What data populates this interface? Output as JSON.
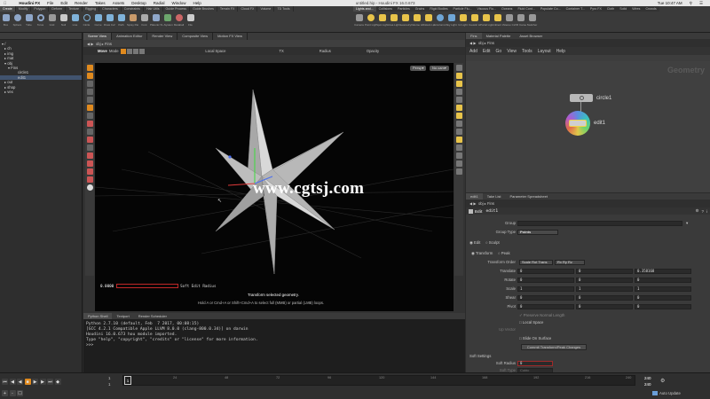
{
  "menubar": {
    "app": "Houdini FX",
    "items": [
      "File",
      "Edit",
      "Render",
      "Takes",
      "Assets",
      "Desktop",
      "Radial",
      "Window",
      "Help"
    ],
    "file_title": "untitled.hip - Houdini FX 16.0.673",
    "time": "Tue 10:47 AM"
  },
  "shelf": {
    "left_tabs": [
      "Create",
      "Modify",
      "Polygon",
      "Deform",
      "Texture",
      "Rigging",
      "Characters",
      "Constraints",
      "Hair Utils",
      "Guide Process",
      "Guide Brushes",
      "Terrain FX",
      "Cloud FX",
      "Volume",
      "TD Tools"
    ],
    "left_tools": [
      "Box",
      "Sphere",
      "Tube",
      "Torus",
      "Grid",
      "Null",
      "Line",
      "Circle",
      "Curve",
      "Draw Curve",
      "Path",
      "Spray Paint",
      "Font",
      "Platonic Solids",
      "L-System",
      "Metaball",
      "File"
    ],
    "right_tabs": [
      "Lights and...",
      "Collisions",
      "Particles",
      "Grains",
      "Rigid Bodies",
      "Particle Flu...",
      "Viscous Flu...",
      "Oceans",
      "Fluid Cont...",
      "Populate Co...",
      "Container T...",
      "Pyro FX",
      "Cloth",
      "Solid",
      "Wires",
      "Crowds",
      "Drive Simu..."
    ],
    "right_tools": [
      "Camera",
      "Point Light",
      "Spot Light",
      "Area Light",
      "Geometry Light",
      "Volume Light",
      "Distant Light",
      "Environment Light",
      "Sky Light",
      "GI Light",
      "Caustic Light",
      "Portal Light",
      "Ambient Light",
      "Stereo Camera",
      "VR Camera",
      "Switcher"
    ]
  },
  "tree": {
    "items": [
      {
        "label": "/",
        "indent": 0
      },
      {
        "label": "ch",
        "indent": 1
      },
      {
        "label": "img",
        "indent": 1
      },
      {
        "label": "mat",
        "indent": 1
      },
      {
        "label": "obj",
        "indent": 1
      },
      {
        "label": "Fins",
        "indent": 2
      },
      {
        "label": "circle1",
        "indent": 3
      },
      {
        "label": "edit1",
        "indent": 3,
        "selected": true
      },
      {
        "label": "out",
        "indent": 1
      },
      {
        "label": "shop",
        "indent": 1
      },
      {
        "label": "vex",
        "indent": 1
      }
    ]
  },
  "scene": {
    "tabs": [
      "Scene View",
      "Animation Editor",
      "Render View",
      "Composite View",
      "Motion FX View"
    ],
    "path": [
      "obj",
      "Fins"
    ],
    "tool_name": "Move",
    "mode_label": "Mode",
    "local_space": "Local Space",
    "field_tx": "TX",
    "field_radius": "Radius",
    "field_opacity": "Opacity",
    "persp": "Persp▾",
    "nocam": "No cam▾",
    "soft_value": "0.0000",
    "soft_label": "Soft Edit Radius",
    "status_title": "Transform selected geometry.",
    "status_hint": "Hold A or Cmd+A or Shift+Cmd+A to select full (MMB) or partial (LMB) loops.",
    "watermark": "www.cgtsj.com"
  },
  "python": {
    "tabs": [
      "Python Shell",
      "Textport",
      "Render Scheduler"
    ],
    "lines": [
      "Python 2.7.10 (default, Feb  7 2017, 00:08:15)",
      "[GCC 4.2.1 Compatible Apple LLVM 8.0.0 (clang-800.0.34)] on darwin",
      "Houdini 16.0.673 hou module imported.",
      "Type \"help\", \"copyright\", \"credits\" or \"license\" for more information.",
      ">>>"
    ]
  },
  "network": {
    "tabs": [
      "Fins",
      "Material Palette",
      "Asset Browser"
    ],
    "path": [
      "obj",
      "Fins"
    ],
    "menu": [
      "Add",
      "Edit",
      "Go",
      "View",
      "Tools",
      "Layout",
      "Help"
    ],
    "context_label": "Geometry",
    "nodes": [
      {
        "name": "circle1"
      },
      {
        "name": "edit1"
      }
    ]
  },
  "params": {
    "tabs": [
      "edit1",
      "Take List",
      "Parameter Spreadsheet"
    ],
    "path": [
      "obj",
      "Fins"
    ],
    "node_type": "Edit",
    "node_name": "edit1",
    "group_label": "Group",
    "group_type_label": "Group Type",
    "group_type_value": "Points",
    "edit_radio": "Edit",
    "sculpt_radio": "Sculpt",
    "transform_radio": "Transform",
    "peak_radio": "Peak",
    "transform_order_label": "Transform Order",
    "transform_order_value": "Scale Rot Trans",
    "rot_order_value": "Rx Ry Rz",
    "rows": [
      {
        "label": "Translate",
        "x": "0",
        "y": "0",
        "z": "0.358168"
      },
      {
        "label": "Rotate",
        "x": "0",
        "y": "0",
        "z": "0"
      },
      {
        "label": "Scale",
        "x": "1",
        "y": "1",
        "z": "1"
      },
      {
        "label": "Shear",
        "x": "0",
        "y": "0",
        "z": "0"
      },
      {
        "label": "Pivot",
        "x": "0",
        "y": "0",
        "z": "0"
      }
    ],
    "preserve_normal": "Preserve Normal Length",
    "local_space": "Local Space",
    "up_vector": "Up Vector",
    "slide_on_surface": "Slide On Surface",
    "commit_button": "Commit Transform/Peak Changes",
    "soft_settings": "Soft Settings",
    "soft_radius_label": "Soft Radius",
    "soft_radius_value": "0",
    "soft_type_label": "Soft Type",
    "soft_type_value": "Cubic"
  },
  "timeline": {
    "start_frame": "1",
    "start_frame2": "1",
    "ticks": [
      "1",
      "24",
      "48",
      "72",
      "96",
      "120",
      "144",
      "168",
      "192",
      "216",
      "240"
    ],
    "end_a": "240",
    "end_b": "240",
    "auto_update": "Auto Update"
  },
  "colors": {
    "accent_orange": "#e08a1e",
    "node_selected": "#f0d44a",
    "selection_blue": "#41536e"
  }
}
